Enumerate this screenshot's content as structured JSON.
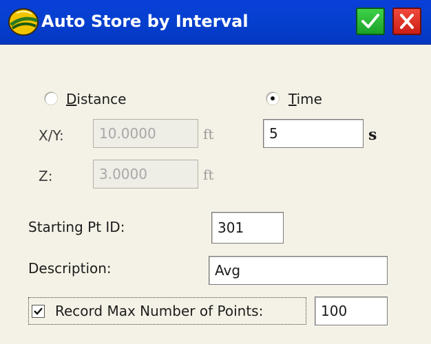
{
  "window": {
    "title": "Auto Store by Interval"
  },
  "icons": {
    "app_logo": "carlson-helmet-logo-icon",
    "ok": "checkmark-icon",
    "close": "close-x-icon"
  },
  "colors": {
    "titlebar": "#0540cf",
    "ok_button": "#26b533",
    "close_button": "#e23528",
    "background": "#f4f2e6"
  },
  "mode": {
    "distance": {
      "prefix": "",
      "underlined": "D",
      "rest": "istance",
      "selected": false
    },
    "time": {
      "prefix": "",
      "underlined": "T",
      "rest": "ime",
      "selected": true
    }
  },
  "distance_fields": {
    "xy_label": "X/Y:",
    "xy_value": "10.0000",
    "xy_unit": "ft",
    "z_label": "Z:",
    "z_value": "3.0000",
    "z_unit": "ft"
  },
  "time_field": {
    "value": "5",
    "unit": "s"
  },
  "starting_pt": {
    "label": "Starting Pt ID:",
    "value": "301"
  },
  "description": {
    "label": "Description:",
    "value": "Avg"
  },
  "record_max": {
    "checked": true,
    "label": "Record Max Number of Points:",
    "value": "100"
  }
}
